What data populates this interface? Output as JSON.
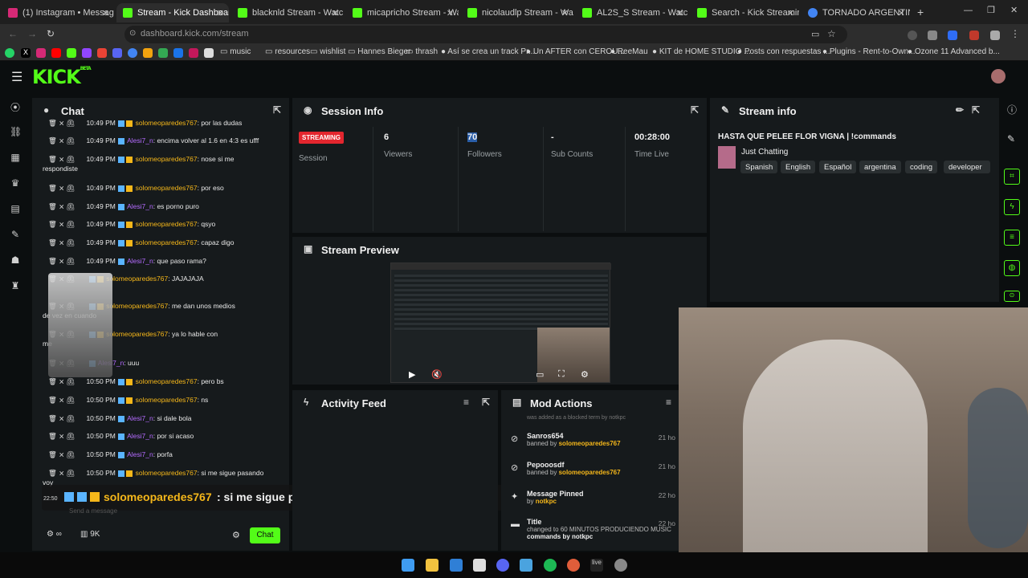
{
  "browser": {
    "tabs": [
      {
        "title": "(1) Instagram • Messages",
        "color": "#d62976"
      },
      {
        "title": "Stream - Kick Dashboard",
        "color": "#53fc18"
      },
      {
        "title": "blacknld Stream - Watch",
        "color": "#53fc18"
      },
      {
        "title": "micapricho Stream - Wat",
        "color": "#53fc18"
      },
      {
        "title": "nicolaudlp Stream - Watch Li",
        "color": "#53fc18"
      },
      {
        "title": "AL2S_S Stream - Watch Live",
        "color": "#53fc18"
      },
      {
        "title": "Search - Kick Streaming",
        "color": "#53fc18"
      },
      {
        "title": "TORNADO ARGENTINA 2012",
        "color": "#4285f4"
      }
    ],
    "url": "dashboard.kick.com/stream",
    "bookmarks": [
      "music",
      "resources",
      "wishlist",
      "Hannes Bieger",
      "thrash",
      "Así se crea un track Pr...",
      "Un AFTER con CEROU...",
      "ReeMau",
      "KIT de HOME STUDIO ...",
      "Posts con respuestas ...",
      "Plugins - Rent-to-Own...",
      "Ozone 11 Advanced b..."
    ]
  },
  "kick": {
    "logo": "KICK",
    "logo_sup": "BETA"
  },
  "chat": {
    "title": "Chat",
    "messages": [
      {
        "time": "10:49 PM",
        "user": "solomeoparedes767",
        "text": ": por las dudas",
        "kind": "u1"
      },
      {
        "time": "10:49 PM",
        "user": "Alesi7_n",
        "text": ": encima volver al 1.6 en 4:3 es ufff",
        "kind": "u2"
      },
      {
        "time": "10:49 PM",
        "user": "solomeoparedes767",
        "text": ": nose si me",
        "kind": "u1",
        "cont": "respondiste"
      },
      {
        "time": "10:49 PM",
        "user": "solomeoparedes767",
        "text": ": por eso",
        "kind": "u1"
      },
      {
        "time": "10:49 PM",
        "user": "Alesi7_n",
        "text": ": es porno puro",
        "kind": "u2"
      },
      {
        "time": "10:49 PM",
        "user": "solomeoparedes767",
        "text": ": qsyo",
        "kind": "u1"
      },
      {
        "time": "10:49 PM",
        "user": "solomeoparedes767",
        "text": ": capaz digo",
        "kind": "u1"
      },
      {
        "time": "10:49 PM",
        "user": "Alesi7_n",
        "text": ": que paso rama?",
        "kind": "u2"
      },
      {
        "time": "",
        "user": "solomeoparedes767",
        "text": ": JAJAJAJA",
        "kind": "u1"
      },
      {
        "time": "",
        "user": "solomeoparedes767",
        "text": ": me dan unos medios",
        "kind": "u1",
        "cont": "de vez en cuando"
      },
      {
        "time": "",
        "user": "solomeoparedes767",
        "text": ": ya lo hable con",
        "kind": "u1",
        "cont": "me"
      },
      {
        "time": "",
        "user": "Alesi7_n",
        "text": ": uuu",
        "kind": "u2"
      },
      {
        "time": "10:50 PM",
        "user": "solomeoparedes767",
        "text": ": pero bs",
        "kind": "u1"
      },
      {
        "time": "10:50 PM",
        "user": "solomeoparedes767",
        "text": ": ns",
        "kind": "u1"
      },
      {
        "time": "10:50 PM",
        "user": "Alesi7_n",
        "text": ": si dale bola",
        "kind": "u2"
      },
      {
        "time": "10:50 PM",
        "user": "Alesi7_n",
        "text": ": por si acaso",
        "kind": "u2"
      },
      {
        "time": "10:50 PM",
        "user": "Alesi7_n",
        "text": ": porfa",
        "kind": "u2"
      },
      {
        "time": "10:50 PM",
        "user": "solomeoparedes767",
        "text": ": si me sigue pasando",
        "kind": "u1",
        "cont": "voy"
      }
    ],
    "overlay": {
      "time": "22:50",
      "user": "solomeoparedes767",
      "text": ": si me sigue pasando voy"
    },
    "input_placeholder": "Send a message",
    "viewer_count": "9K",
    "send_label": "Chat"
  },
  "session": {
    "title": "Session Info",
    "status": "STREAMING",
    "status_label": "Session",
    "stats": [
      {
        "value": "6",
        "label": "Viewers"
      },
      {
        "value": "70",
        "label": "Followers"
      },
      {
        "value": "-",
        "label": "Sub Counts"
      },
      {
        "value": "00:28:00",
        "label": "Time Live"
      }
    ]
  },
  "preview": {
    "title": "Stream Preview"
  },
  "stream_info": {
    "title": "Stream info",
    "stream_title": "HASTA QUE PELEE FLOR VIGNA | !commands",
    "category": "Just Chatting",
    "tags": [
      "Spanish",
      "English",
      "Español",
      "argentina",
      "coding",
      "developer"
    ]
  },
  "activity": {
    "title": "Activity Feed"
  },
  "mod_actions": {
    "title": "Mod Actions",
    "clipped_top": "was added as a blocked term by notkpc",
    "items": [
      {
        "name": "Sanros654",
        "detail": "banned by",
        "by": "solomeoparedes767",
        "when": "21 ho"
      },
      {
        "name": "Pepooosdf",
        "detail": "banned by",
        "by": "solomeoparedes767",
        "when": "21 ho"
      },
      {
        "name": "Message Pinned",
        "detail": "by",
        "by": "notkpc",
        "when": "22 ho"
      },
      {
        "name": "Title",
        "detail": "changed to 60 MINUTOS PRODUCIENDO MUSIC",
        "by": "commands by notkpc",
        "when": "22 ho"
      }
    ]
  },
  "colors": {
    "accent": "#53fc18",
    "streaming": "#e3262e",
    "user_gold": "#f5b71a",
    "user_purple": "#b46bff"
  }
}
